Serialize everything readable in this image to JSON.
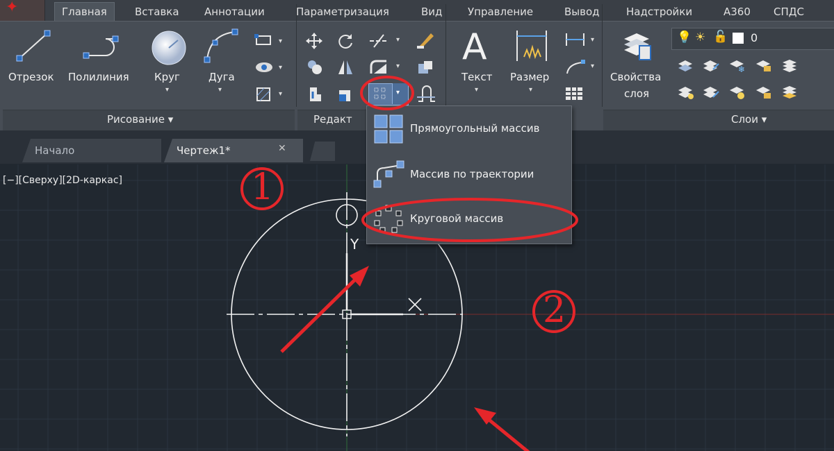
{
  "ribbon_tabs": [
    "Главная",
    "Вставка",
    "Аннотации",
    "Параметризация",
    "Вид",
    "Управление",
    "Вывод",
    "Надстройки",
    "А360",
    "СПДС"
  ],
  "draw_panel": {
    "title": "Рисование ▾",
    "line": "Отрезок",
    "polyline": "Полилиния",
    "circle": "Круг",
    "arc": "Дуга"
  },
  "modify_panel": {
    "title": "Редакт"
  },
  "annotation_panel": {
    "text": "Текст",
    "dimension": "Размер"
  },
  "layers_panel": {
    "title": "Слои ▾",
    "properties_line1": "Свойства",
    "properties_line2": "слоя",
    "current_layer": "0"
  },
  "doc_tabs": {
    "start": "Начало",
    "drawing": "Чертеж1*",
    "close": "✕"
  },
  "viewport_label": "[−][Сверху][2D-каркас]",
  "array_menu": {
    "rectangular": "Прямоугольный массив",
    "path": "Массив по траектории",
    "polar": "Круговой массив"
  },
  "ucs": {
    "y_axis": "Y",
    "x_axis": "X"
  },
  "annotations": {
    "marker1": "1",
    "marker2": "2"
  },
  "colors": {
    "accent": "#e5262a",
    "background": "#212830",
    "ribbon": "#474d55"
  }
}
